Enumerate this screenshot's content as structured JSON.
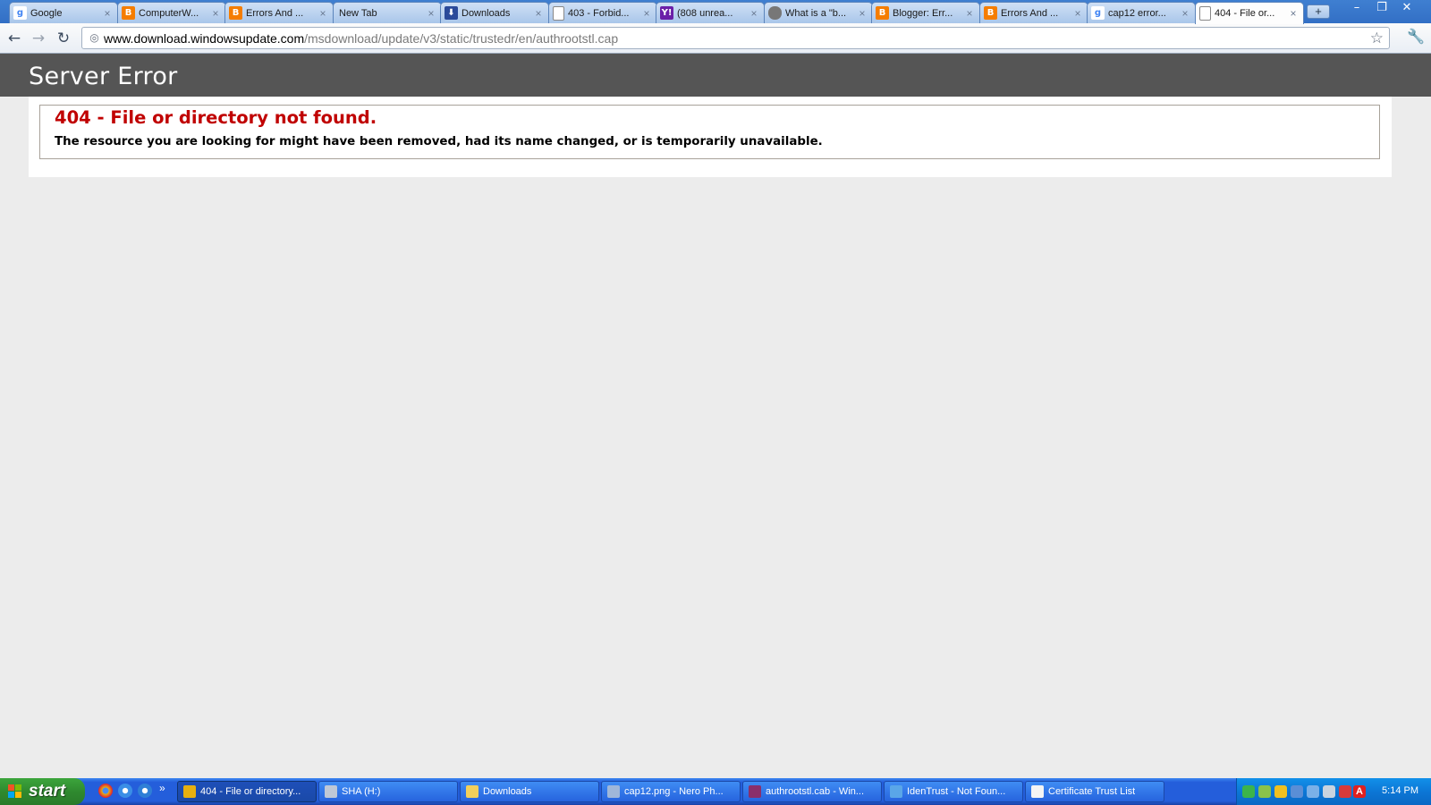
{
  "browser": {
    "tabs": [
      {
        "title": "Google",
        "icon": "google-icon",
        "color": "#4285f4",
        "glyph": "g"
      },
      {
        "title": "ComputerW...",
        "icon": "blogger-icon",
        "color": "#f57d00",
        "glyph": "B"
      },
      {
        "title": "Errors And ...",
        "icon": "blogger-icon",
        "color": "#f57d00",
        "glyph": "B"
      },
      {
        "title": "New Tab",
        "icon": "none",
        "color": "",
        "glyph": ""
      },
      {
        "title": "Downloads",
        "icon": "download-icon",
        "color": "#2a4a9a",
        "glyph": "⬇"
      },
      {
        "title": "403 - Forbid...",
        "icon": "page-icon",
        "color": "#ffffff",
        "glyph": ""
      },
      {
        "title": "(808 unrea...",
        "icon": "yahoo-icon",
        "color": "#6b1fa8",
        "glyph": "Y!"
      },
      {
        "title": "What is a \"b...",
        "icon": "avatar-icon",
        "color": "#777777",
        "glyph": ""
      },
      {
        "title": "Blogger: Err...",
        "icon": "blogger-icon",
        "color": "#f57d00",
        "glyph": "B"
      },
      {
        "title": "Errors And ...",
        "icon": "blogger-icon",
        "color": "#f57d00",
        "glyph": "B"
      },
      {
        "title": "cap12 error...",
        "icon": "google-icon",
        "color": "#4285f4",
        "glyph": "g"
      },
      {
        "title": "404 - File or...",
        "icon": "page-icon",
        "color": "#ffffff",
        "glyph": ""
      }
    ],
    "active_tab": 11,
    "new_tab_label": "+",
    "url_host": "www.download.windowsupdate.com",
    "url_path": "/msdownload/update/v3/static/trustedr/en/authrootstl.cap"
  },
  "page": {
    "header_title": "Server Error",
    "error_title": "404 - File or directory not found.",
    "error_message": "The resource you are looking for might have been removed, had its name changed, or is temporarily unavailable."
  },
  "colors": {
    "header_bg": "#555555",
    "error_title": "#c00000",
    "page_bg": "#ececec"
  },
  "taskbar": {
    "start_label": "start",
    "tasks": [
      {
        "label": "404 - File or directory...",
        "icon": "chrome-icon",
        "color": "#e8b010",
        "active": true
      },
      {
        "label": "SHA (H:)",
        "icon": "drive-icon",
        "color": "#bfc8d6",
        "active": false
      },
      {
        "label": "Downloads",
        "icon": "folder-icon",
        "color": "#f2cf5b",
        "active": false
      },
      {
        "label": "cap12.png - Nero Ph...",
        "icon": "image-viewer-icon",
        "color": "#9fb7d9",
        "active": false
      },
      {
        "label": "authrootstl.cab - Win...",
        "icon": "winrar-icon",
        "color": "#8a2f6b",
        "active": false
      },
      {
        "label": "IdenTrust - Not Foun...",
        "icon": "ie-icon",
        "color": "#5aa6e8",
        "active": false
      },
      {
        "label": "Certificate Trust List",
        "icon": "certificate-icon",
        "color": "#f4f4f4",
        "active": false
      }
    ],
    "clock": "5:14 PM"
  }
}
